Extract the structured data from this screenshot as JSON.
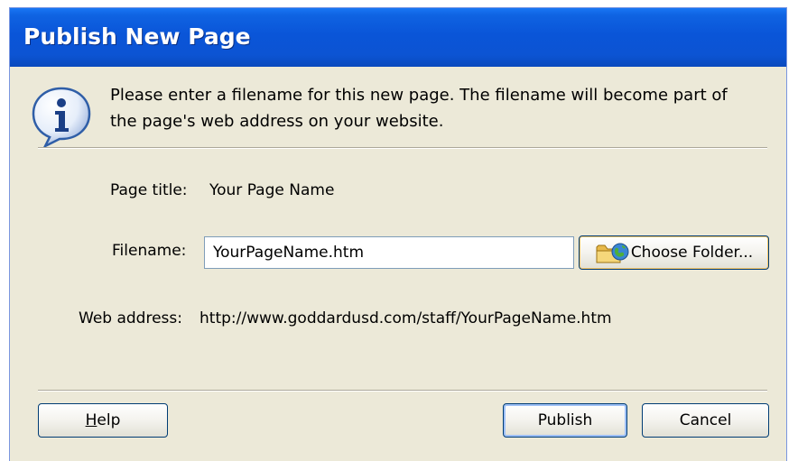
{
  "window": {
    "title": "Publish New Page"
  },
  "info": {
    "icon": "info-icon",
    "message_line1": "Please enter a filename for this new page. The filename will become part of",
    "message_line2": "the page's web address on your website."
  },
  "form": {
    "page_title_label": "Page title:",
    "page_title_value": "Your Page Name",
    "filename_label": "Filename:",
    "filename_value": "YourPageName.htm",
    "choose_folder_label": "Choose Folder...",
    "choose_folder_icon": "folder-globe-icon",
    "web_address_label": "Web address:",
    "web_address_value": "http://www.goddardusd.com/staff/YourPageName.htm"
  },
  "buttons": {
    "help_mnemonic": "H",
    "help_rest": "elp",
    "publish_label": "Publish",
    "cancel_label": "Cancel"
  },
  "colors": {
    "titlebar": "#0a55d8",
    "dialog_bg": "#ece9d8",
    "button_border": "#003c74"
  }
}
